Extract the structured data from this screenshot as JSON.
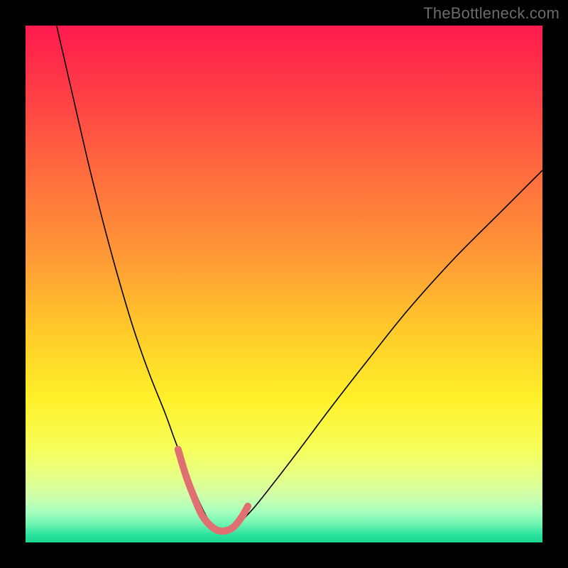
{
  "watermark": "TheBottleneck.com",
  "chart_data": {
    "type": "line",
    "title": "",
    "xlabel": "",
    "ylabel": "",
    "xlim": [
      0,
      100
    ],
    "ylim": [
      0,
      100
    ],
    "grid": false,
    "legend": false,
    "background_gradient": {
      "direction": "vertical",
      "stops": [
        {
          "pos": 0.0,
          "color": "#ff1a4e"
        },
        {
          "pos": 0.12,
          "color": "#ff3b47"
        },
        {
          "pos": 0.28,
          "color": "#ff6a3e"
        },
        {
          "pos": 0.45,
          "color": "#ff9a36"
        },
        {
          "pos": 0.58,
          "color": "#ffc72a"
        },
        {
          "pos": 0.72,
          "color": "#fff029"
        },
        {
          "pos": 0.82,
          "color": "#f6ff5a"
        },
        {
          "pos": 0.87,
          "color": "#e7ff85"
        },
        {
          "pos": 0.91,
          "color": "#cfffaa"
        },
        {
          "pos": 0.94,
          "color": "#a8ffbe"
        },
        {
          "pos": 0.965,
          "color": "#6cf3b1"
        },
        {
          "pos": 0.985,
          "color": "#2be39e"
        },
        {
          "pos": 1.0,
          "color": "#19d890"
        }
      ]
    },
    "series": [
      {
        "name": "curve",
        "color": "#000000",
        "stroke_width": 1.6,
        "x": [
          6,
          9,
          12,
          15,
          18,
          21,
          24,
          27,
          29,
          31,
          32.5,
          34,
          35.5,
          37,
          39,
          41,
          44,
          48,
          53,
          59,
          66,
          74,
          83,
          92,
          100
        ],
        "y": [
          100,
          87,
          74,
          62,
          51,
          41,
          32.5,
          25,
          19.5,
          14.5,
          10.5,
          7,
          4.2,
          2.5,
          2.2,
          3.5,
          6.5,
          11.5,
          18,
          26,
          35,
          45,
          55,
          64,
          72
        ]
      }
    ],
    "highlight_band": {
      "name": "optimal-range",
      "color": "#e06f72",
      "stroke_width": 10,
      "linecap": "round",
      "x": [
        29.5,
        31,
        32.5,
        34,
        35.5,
        37,
        38.5,
        40,
        41,
        42,
        43
      ],
      "y": [
        18,
        13,
        9,
        5.5,
        3.5,
        2.4,
        2.2,
        2.8,
        3.8,
        5.2,
        7.0
      ]
    },
    "annotations": []
  }
}
